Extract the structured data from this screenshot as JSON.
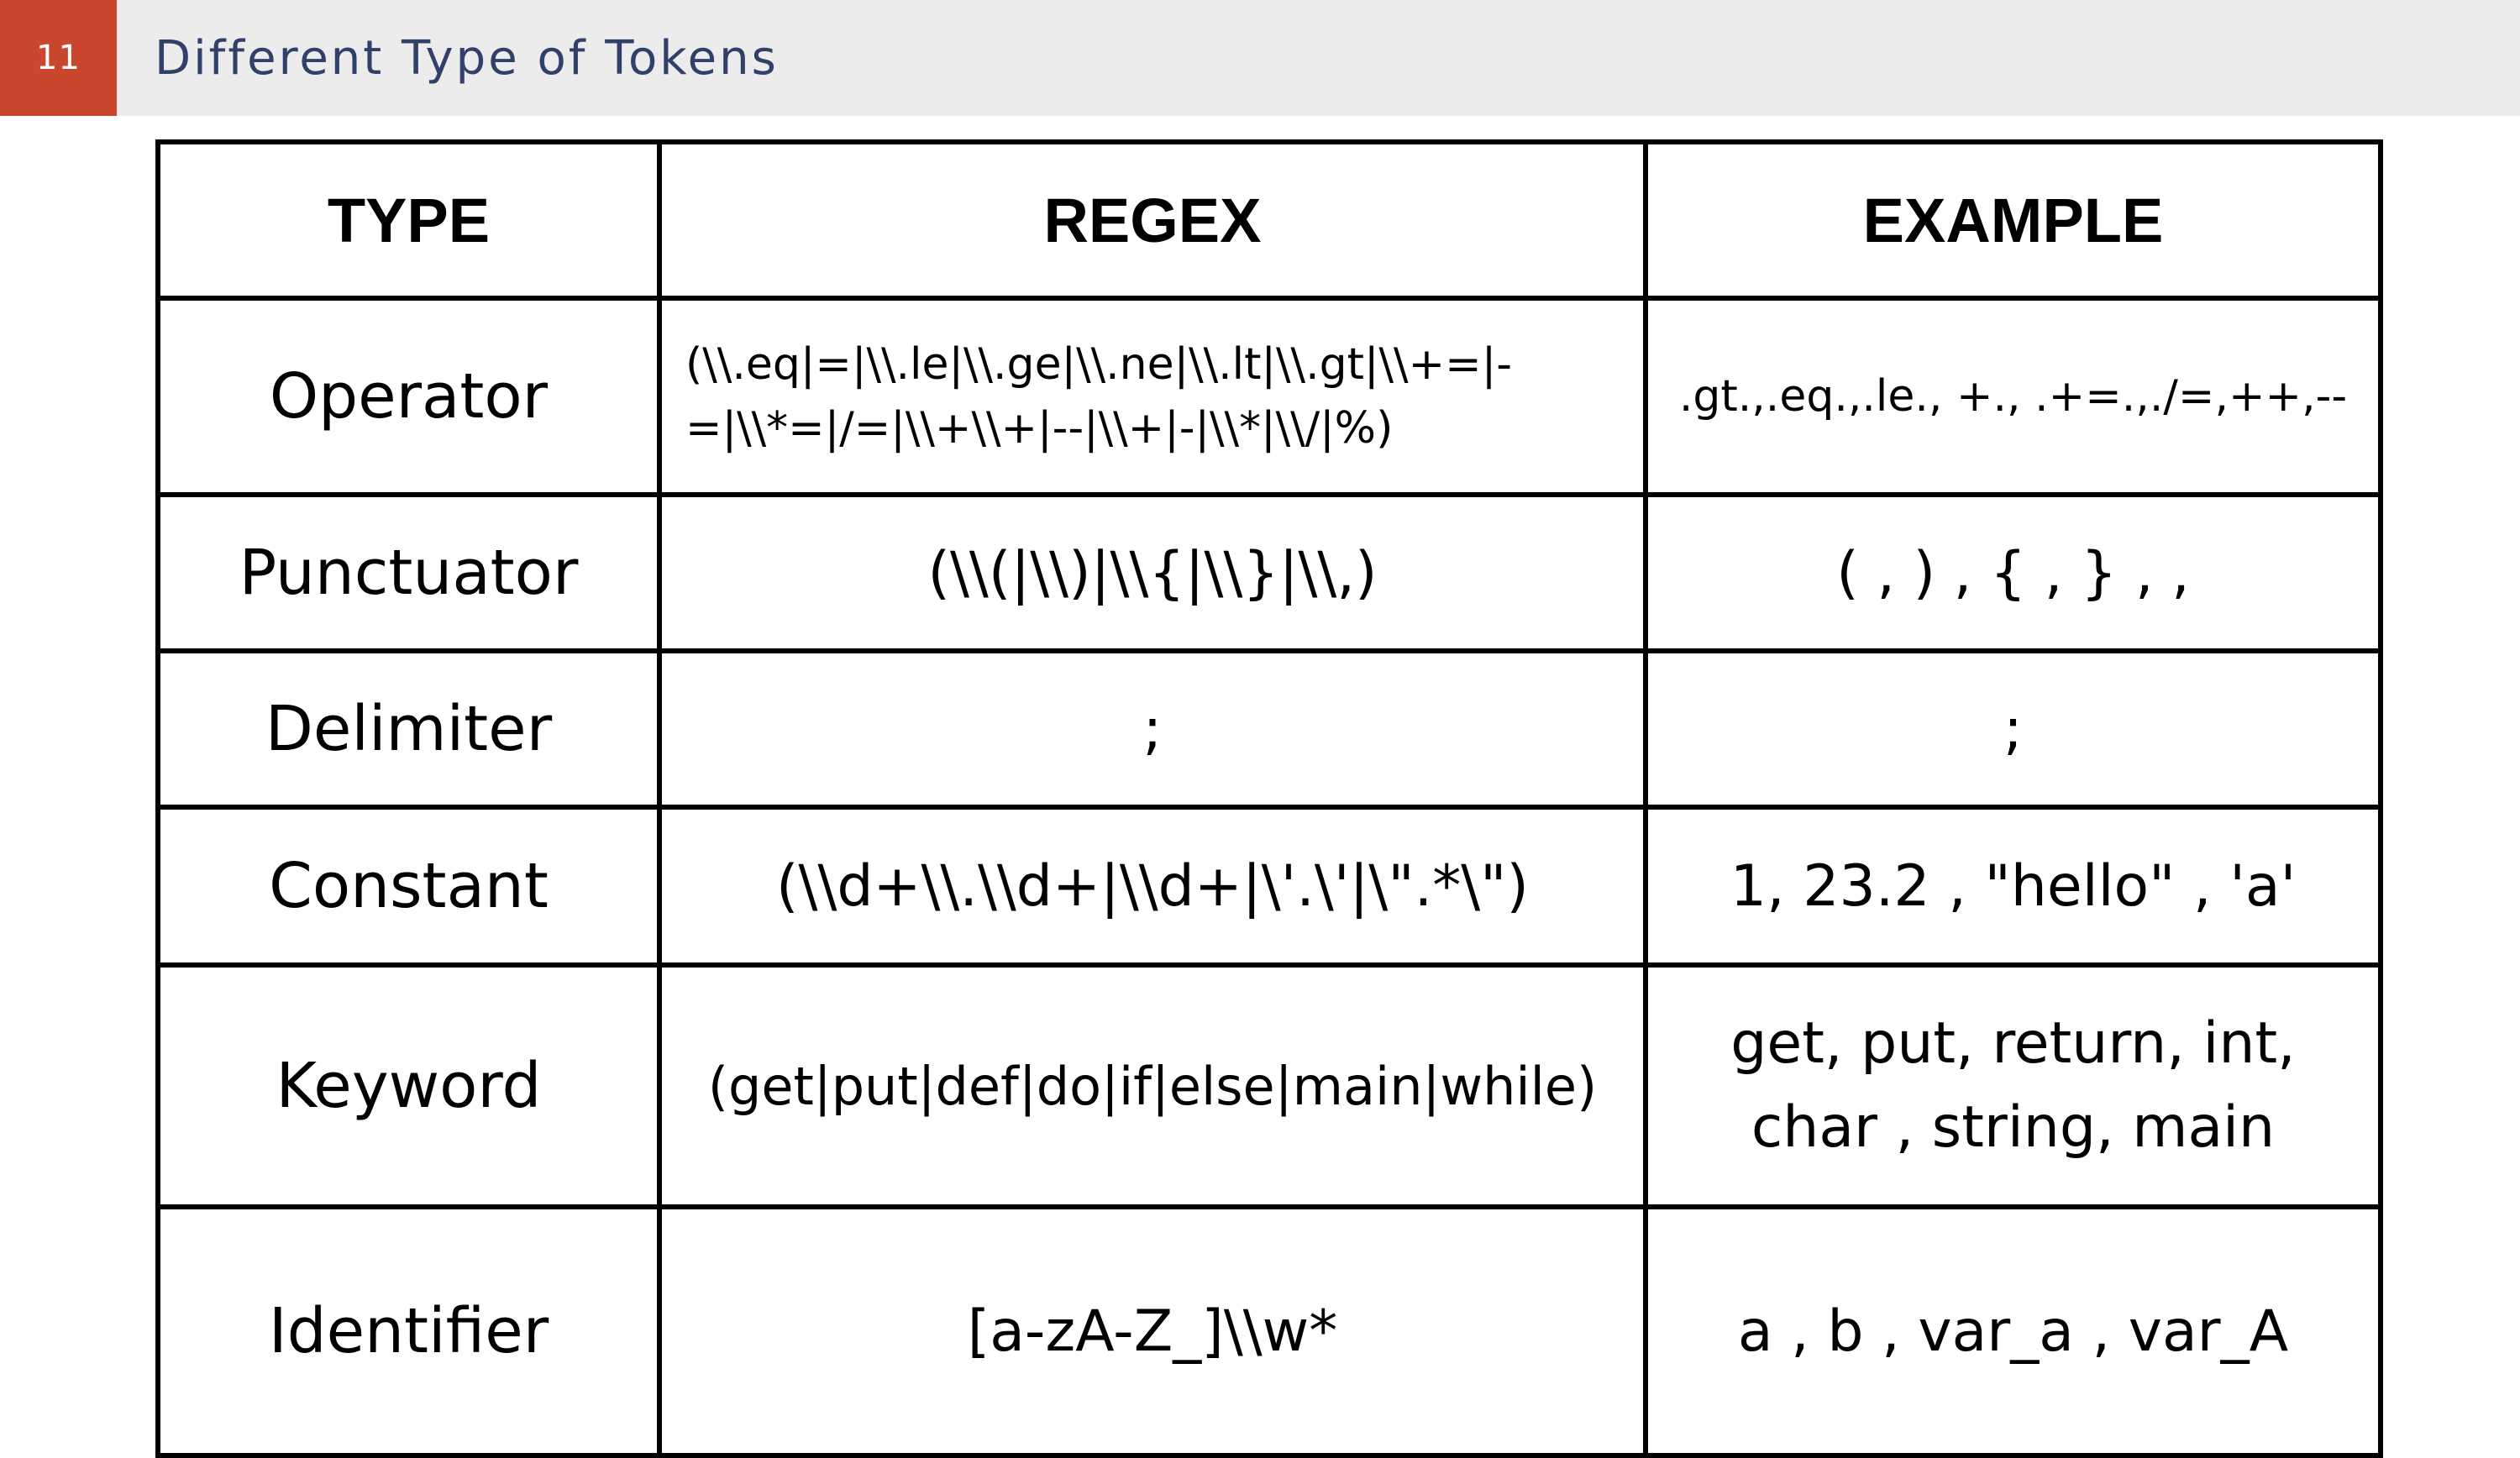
{
  "header": {
    "slide_number": "11",
    "title": "Different Type of Tokens",
    "colors": {
      "number_bg": "#c8472d",
      "title_bar_bg": "#ececec",
      "title_text": "#2f4168"
    }
  },
  "table": {
    "columns": [
      "TYPE",
      "REGEX",
      "EXAMPLE"
    ],
    "rows": [
      {
        "type": "Operator",
        "regex": "(\\\\.eq|=|\\\\.le|\\\\.ge|\\\\.ne|\\\\.lt|\\\\.gt|\\\\+=|-=|\\\\*=|/=|\\\\+\\\\+|--|\\\\+|-|\\\\*|\\\\/|%)",
        "example": ".gt.,.eq.,.le., +., .+=.,./=,++,--"
      },
      {
        "type": "Punctuator",
        "regex": "(\\\\(|\\\\)|\\\\{|\\\\}|\\\\,)",
        "example": "( , ) , { , } , ,"
      },
      {
        "type": "Delimiter",
        "regex": ";",
        "example": ";"
      },
      {
        "type": "Constant",
        "regex": "(\\\\d+\\\\.\\\\d+|\\\\d+|\\'.\\'|\\\".*\\\")",
        "example": "1, 23.2 , \"hello\" , 'a'"
      },
      {
        "type": "Keyword",
        "regex": "(get|put|def|do|if|else|main|while)",
        "example": "get, put, return, int, char , string, main"
      },
      {
        "type": "Identifier",
        "regex": "[a-zA-Z_]\\\\w*",
        "example": "a , b , var_a , var_A"
      }
    ]
  }
}
